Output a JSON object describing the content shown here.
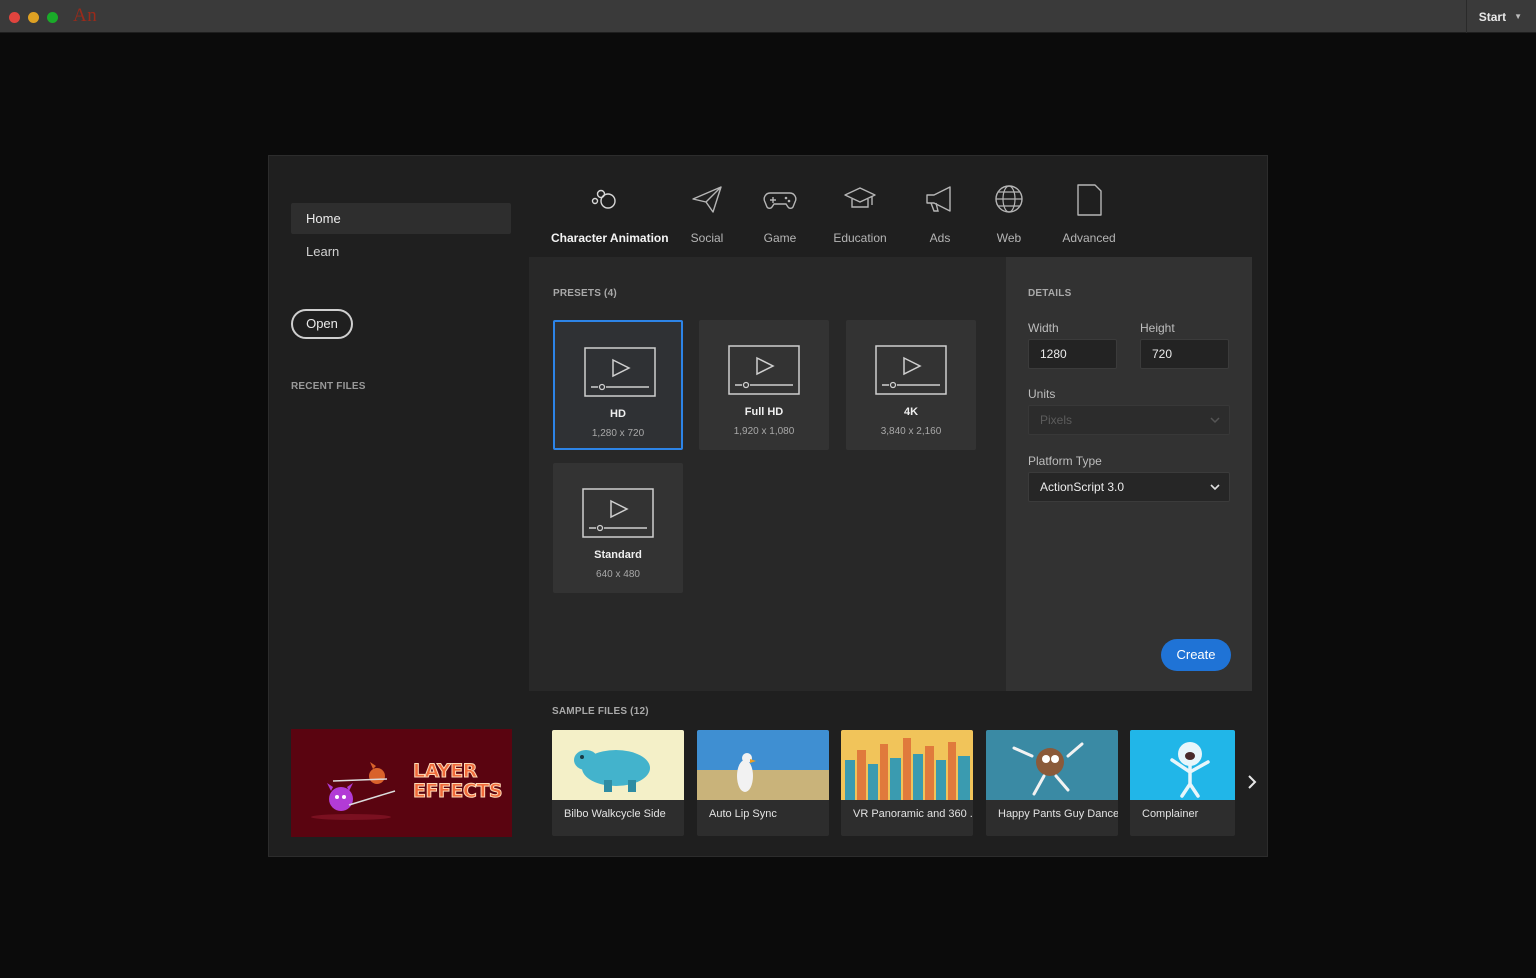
{
  "titlebar": {
    "app_logo": "An",
    "workspace_label": "Start"
  },
  "sidebar": {
    "items": [
      {
        "label": "Home"
      },
      {
        "label": "Learn"
      }
    ],
    "open_label": "Open",
    "recent_files_title": "RECENT FILES",
    "promo_text_line1": "LAYER",
    "promo_text_line2": "EFFECTS"
  },
  "tabs": [
    {
      "label": "Character Animation",
      "icon": "character-animation-icon",
      "active": true
    },
    {
      "label": "Social",
      "icon": "paper-plane-icon"
    },
    {
      "label": "Game",
      "icon": "gamepad-icon"
    },
    {
      "label": "Education",
      "icon": "graduation-cap-icon"
    },
    {
      "label": "Ads",
      "icon": "megaphone-icon"
    },
    {
      "label": "Web",
      "icon": "globe-icon"
    },
    {
      "label": "Advanced",
      "icon": "document-icon"
    }
  ],
  "presets": {
    "title": "PRESETS (4)",
    "items": [
      {
        "name": "HD",
        "dims": "1,280 x 720",
        "selected": true
      },
      {
        "name": "Full HD",
        "dims": "1,920 x 1,080"
      },
      {
        "name": "4K",
        "dims": "3,840 x 2,160"
      },
      {
        "name": "Standard",
        "dims": "640 x 480"
      }
    ]
  },
  "details": {
    "title": "DETAILS",
    "width_label": "Width",
    "width_value": "1280",
    "height_label": "Height",
    "height_value": "720",
    "units_label": "Units",
    "units_value": "Pixels",
    "platform_label": "Platform Type",
    "platform_value": "ActionScript 3.0",
    "create_label": "Create"
  },
  "samples": {
    "title": "SAMPLE FILES (12)",
    "items": [
      {
        "label": "Bilbo Walkcycle Side"
      },
      {
        "label": "Auto Lip Sync"
      },
      {
        "label": "VR Panoramic and 360 ..."
      },
      {
        "label": "Happy Pants Guy Dance"
      },
      {
        "label": "Complainer"
      }
    ]
  },
  "colors": {
    "accent": "#1f73d6",
    "selected_border": "#2d84e7",
    "background": "#0b0b0b",
    "dialog": "#1f1f1f"
  }
}
